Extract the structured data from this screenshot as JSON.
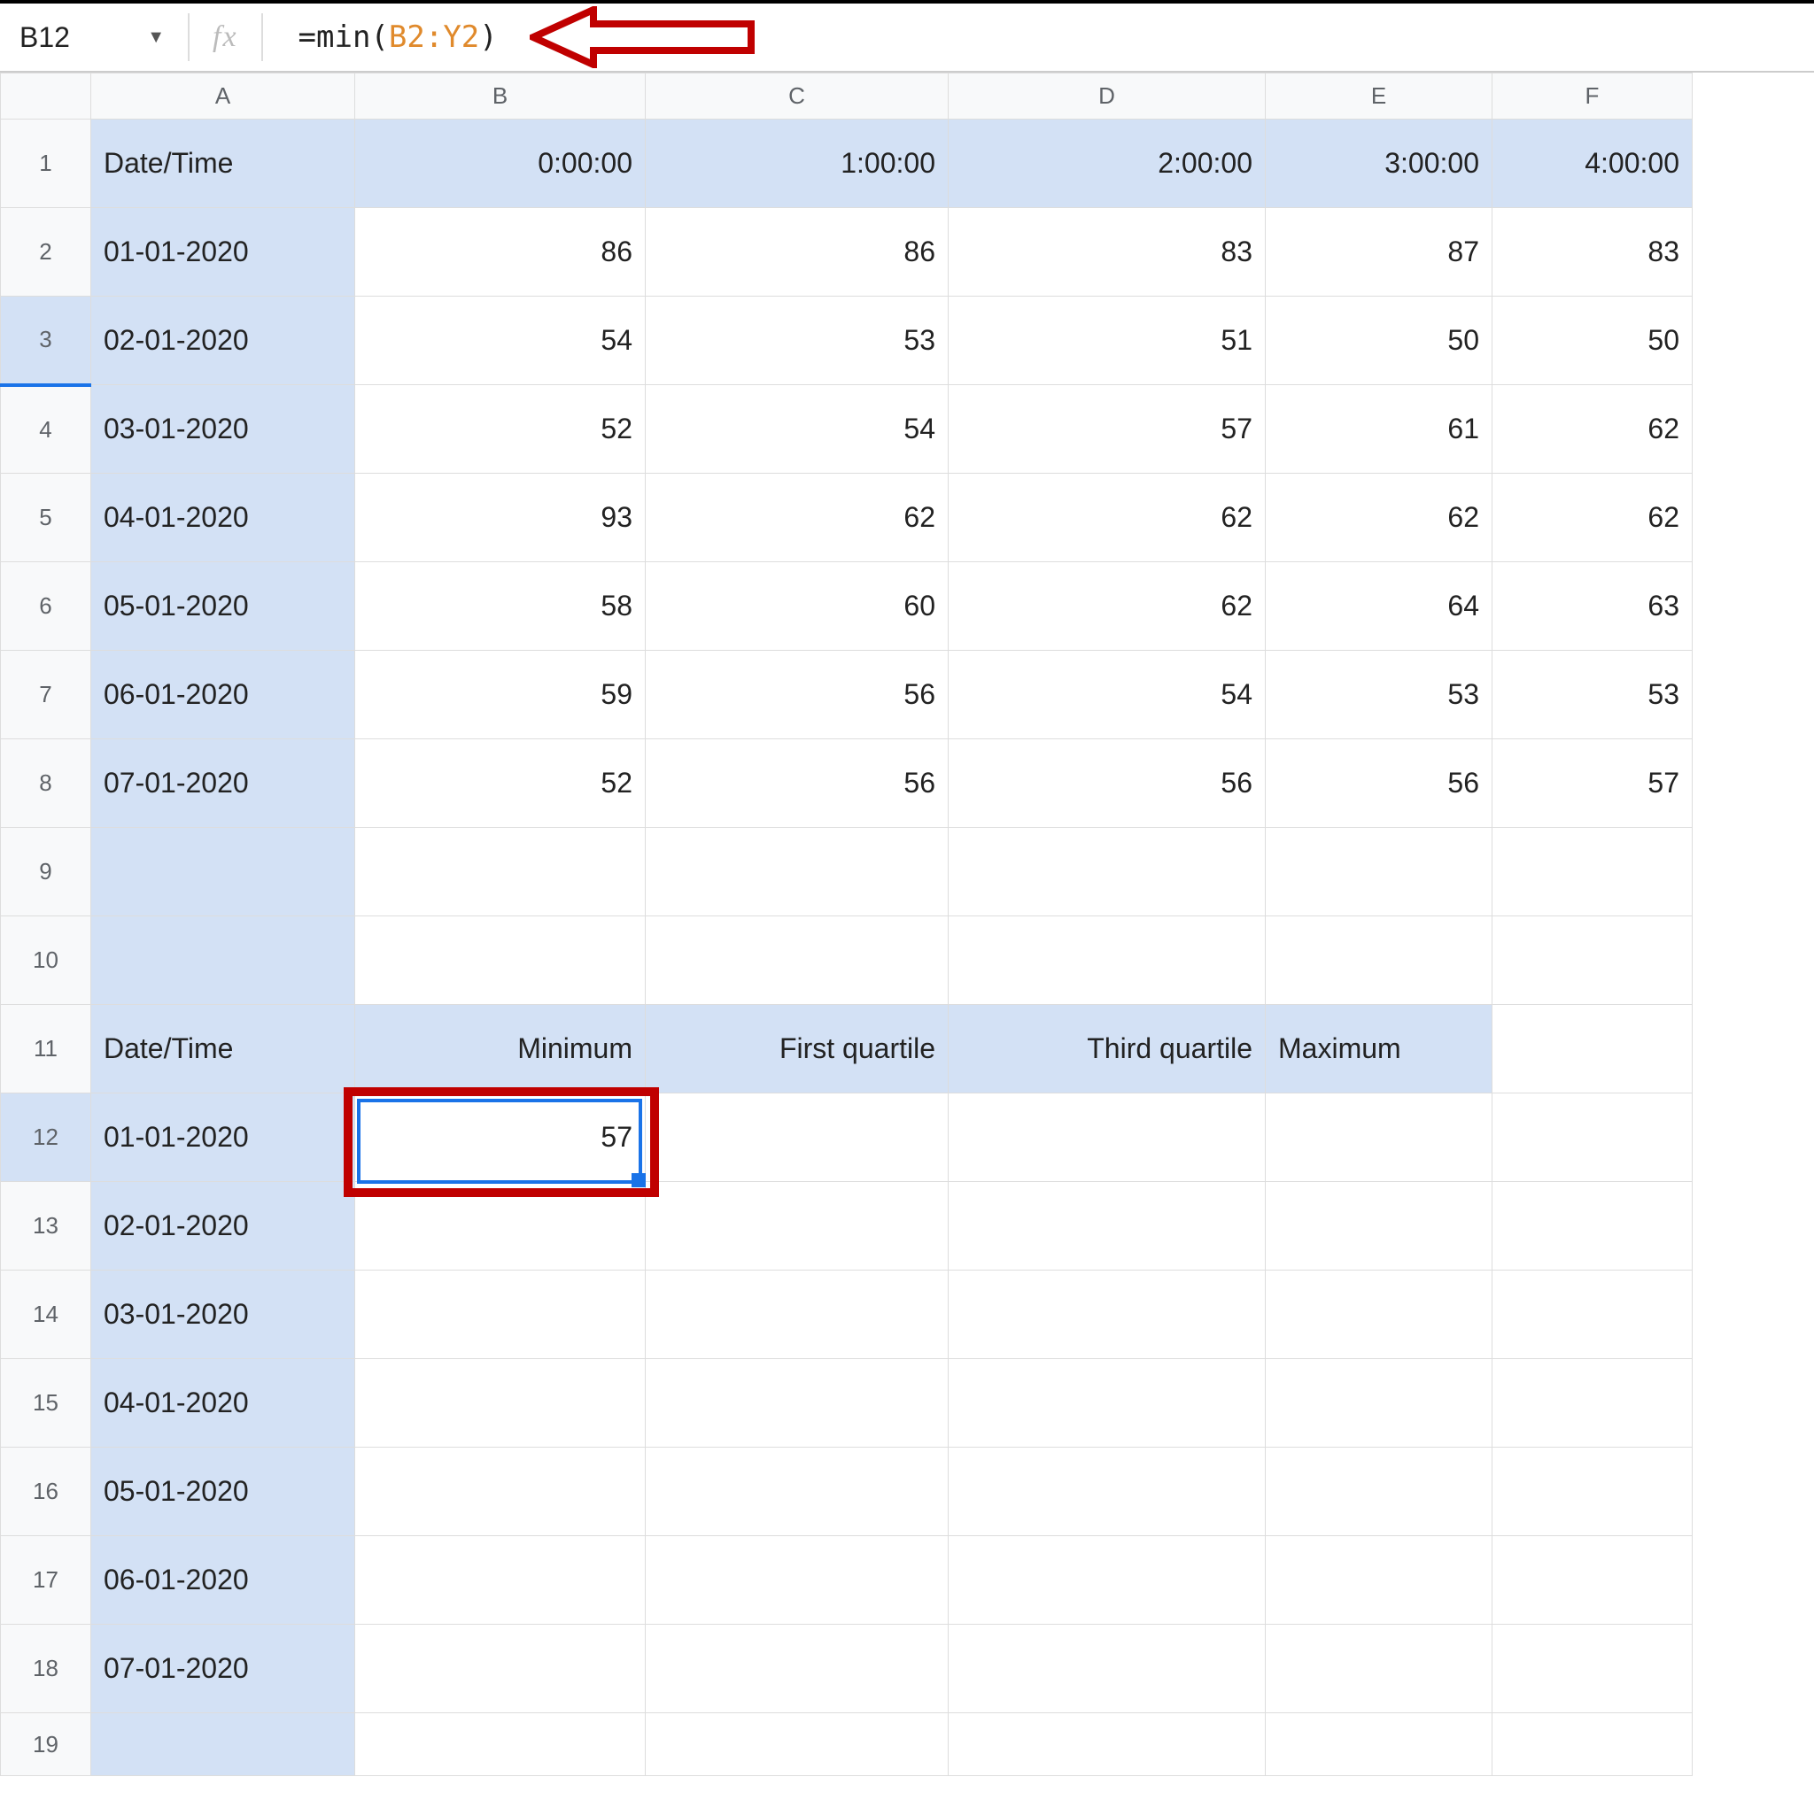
{
  "name_box": "B12",
  "fx_label": "fx",
  "formula": {
    "prefix": "=min(",
    "range": "B2:Y2",
    "suffix": ")"
  },
  "cols": [
    "A",
    "B",
    "C",
    "D",
    "E",
    "F"
  ],
  "rows": [
    "1",
    "2",
    "3",
    "4",
    "5",
    "6",
    "7",
    "8",
    "9",
    "10",
    "11",
    "12",
    "13",
    "14",
    "15",
    "16",
    "17",
    "18",
    "19"
  ],
  "r1": {
    "A": "Date/Time",
    "B": "0:00:00",
    "C": "1:00:00",
    "D": "2:00:00",
    "E": "3:00:00",
    "F": "4:00:00"
  },
  "r2": {
    "A": "01-01-2020",
    "B": "86",
    "C": "86",
    "D": "83",
    "E": "87",
    "F": "83"
  },
  "r3": {
    "A": "02-01-2020",
    "B": "54",
    "C": "53",
    "D": "51",
    "E": "50",
    "F": "50"
  },
  "r4": {
    "A": "03-01-2020",
    "B": "52",
    "C": "54",
    "D": "57",
    "E": "61",
    "F": "62"
  },
  "r5": {
    "A": "04-01-2020",
    "B": "93",
    "C": "62",
    "D": "62",
    "E": "62",
    "F": "62"
  },
  "r6": {
    "A": "05-01-2020",
    "B": "58",
    "C": "60",
    "D": "62",
    "E": "64",
    "F": "63"
  },
  "r7": {
    "A": "06-01-2020",
    "B": "59",
    "C": "56",
    "D": "54",
    "E": "53",
    "F": "53"
  },
  "r8": {
    "A": "07-01-2020",
    "B": "52",
    "C": "56",
    "D": "56",
    "E": "56",
    "F": "57"
  },
  "r11": {
    "A": "Date/Time",
    "B": "Minimum",
    "C": "First quartile",
    "D": "Third quartile",
    "E": "Maximum"
  },
  "r12": {
    "A": "01-01-2020",
    "B": "57"
  },
  "r13": {
    "A": "02-01-2020"
  },
  "r14": {
    "A": "03-01-2020"
  },
  "r15": {
    "A": "04-01-2020"
  },
  "r16": {
    "A": "05-01-2020"
  },
  "r17": {
    "A": "06-01-2020"
  },
  "r18": {
    "A": "07-01-2020"
  },
  "annotations": {
    "red_box": {
      "target": "B12"
    },
    "arrow": {
      "points_to": "formula"
    }
  }
}
